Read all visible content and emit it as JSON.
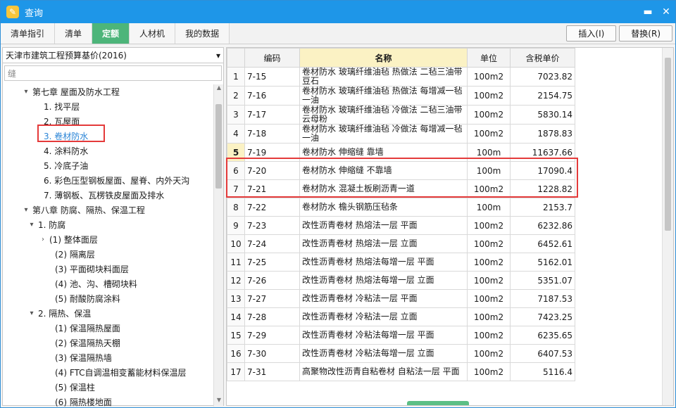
{
  "window": {
    "title": "查询",
    "minimize_symbol": "▬",
    "close_symbol": "✕",
    "app_icon_glyph": "✎"
  },
  "tabs": [
    {
      "label": "清单指引",
      "active": false
    },
    {
      "label": "清单",
      "active": false
    },
    {
      "label": "定额",
      "active": true
    },
    {
      "label": "人材机",
      "active": false
    },
    {
      "label": "我的数据",
      "active": false
    }
  ],
  "buttons": {
    "insert": "插入(I)",
    "replace": "替换(R)"
  },
  "left": {
    "library": "天津市建筑工程预算基价(2016)",
    "search_placeholder": "缝",
    "tree": [
      {
        "indent": 2,
        "caret": "▾",
        "label": "第七章 屋面及防水工程"
      },
      {
        "indent": 4,
        "caret": "",
        "label": "1. 找平层"
      },
      {
        "indent": 4,
        "caret": "",
        "label": "2. 瓦屋面"
      },
      {
        "indent": 4,
        "caret": "",
        "label": "3. 卷材防水",
        "selected": true
      },
      {
        "indent": 4,
        "caret": "",
        "label": "4. 涂料防水"
      },
      {
        "indent": 4,
        "caret": "",
        "label": "5. 冷底子油"
      },
      {
        "indent": 4,
        "caret": "",
        "label": "6. 彩色压型钢板屋面、屋脊、内外天沟"
      },
      {
        "indent": 4,
        "caret": "",
        "label": "7. 薄钢板、瓦楞铁皮屋面及排水"
      },
      {
        "indent": 2,
        "caret": "▾",
        "label": "第八章 防腐、隔热、保温工程"
      },
      {
        "indent": 3,
        "caret": "▾",
        "label": "1. 防腐"
      },
      {
        "indent": 5,
        "caret": "›",
        "label": "(1) 整体面层"
      },
      {
        "indent": 6,
        "caret": "",
        "label": "(2) 隔离层"
      },
      {
        "indent": 6,
        "caret": "",
        "label": "(3) 平面砌块料面层"
      },
      {
        "indent": 6,
        "caret": "",
        "label": "(4) 池、沟、槽砌块料"
      },
      {
        "indent": 6,
        "caret": "",
        "label": "(5) 耐酸防腐涂料"
      },
      {
        "indent": 3,
        "caret": "▾",
        "label": "2. 隔热、保温"
      },
      {
        "indent": 6,
        "caret": "",
        "label": "(1) 保温隔热屋面"
      },
      {
        "indent": 6,
        "caret": "",
        "label": "(2) 保温隔热天棚"
      },
      {
        "indent": 6,
        "caret": "",
        "label": "(3) 保温隔热墙"
      },
      {
        "indent": 6,
        "caret": "",
        "label": "(4) FTC自调温相变蓄能材料保温层"
      },
      {
        "indent": 6,
        "caret": "",
        "label": "(5) 保温柱"
      },
      {
        "indent": 6,
        "caret": "",
        "label": "(6) 隔热楼地面"
      }
    ]
  },
  "table": {
    "headers": [
      "",
      "编码",
      "名称",
      "单位",
      "含税单价"
    ],
    "rows": [
      {
        "idx": "1",
        "code": "7-15",
        "name": "卷材防水 玻璃纤维油毡 热做法 二毡三油带豆石",
        "unit": "100m2",
        "price": "7023.82"
      },
      {
        "idx": "2",
        "code": "7-16",
        "name": "卷材防水 玻璃纤维油毡 热做法 每增减一毡一油",
        "unit": "100m2",
        "price": "2154.75"
      },
      {
        "idx": "3",
        "code": "7-17",
        "name": "卷材防水 玻璃纤维油毡 冷做法 二毡三油带云母粉",
        "unit": "100m2",
        "price": "5830.14"
      },
      {
        "idx": "4",
        "code": "7-18",
        "name": "卷材防水 玻璃纤维油毡 冷做法 每增减一毡一油",
        "unit": "100m2",
        "price": "1878.83"
      },
      {
        "idx": "5",
        "code": "7-19",
        "name": "卷材防水 伸缩缝 靠墙",
        "unit": "100m",
        "price": "11637.66",
        "highlight": true
      },
      {
        "idx": "6",
        "code": "7-20",
        "name": "卷材防水 伸缩缝 不靠墙",
        "unit": "100m",
        "price": "17090.4"
      },
      {
        "idx": "7",
        "code": "7-21",
        "name": "卷材防水 混凝土板刷沥青一道",
        "unit": "100m2",
        "price": "1228.82"
      },
      {
        "idx": "8",
        "code": "7-22",
        "name": "卷材防水 檐头钢筋压毡条",
        "unit": "100m",
        "price": "2153.7"
      },
      {
        "idx": "9",
        "code": "7-23",
        "name": "改性沥青卷材 热熔法一层 平面",
        "unit": "100m2",
        "price": "6232.86"
      },
      {
        "idx": "10",
        "code": "7-24",
        "name": "改性沥青卷材 热熔法一层 立面",
        "unit": "100m2",
        "price": "6452.61"
      },
      {
        "idx": "11",
        "code": "7-25",
        "name": "改性沥青卷材 热熔法每增一层 平面",
        "unit": "100m2",
        "price": "5162.01"
      },
      {
        "idx": "12",
        "code": "7-26",
        "name": "改性沥青卷材 热熔法每增一层 立面",
        "unit": "100m2",
        "price": "5351.07"
      },
      {
        "idx": "13",
        "code": "7-27",
        "name": "改性沥青卷材 冷粘法一层 平面",
        "unit": "100m2",
        "price": "7187.53"
      },
      {
        "idx": "14",
        "code": "7-28",
        "name": "改性沥青卷材 冷粘法一层 立面",
        "unit": "100m2",
        "price": "7423.25"
      },
      {
        "idx": "15",
        "code": "7-29",
        "name": "改性沥青卷材 冷粘法每增一层 平面",
        "unit": "100m2",
        "price": "6235.65"
      },
      {
        "idx": "16",
        "code": "7-30",
        "name": "改性沥青卷材 冷粘法每增一层 立面",
        "unit": "100m2",
        "price": "6407.53"
      },
      {
        "idx": "17",
        "code": "7-31",
        "name": "高聚物改性沥青自粘卷材 自粘法一层 平面",
        "unit": "100m2",
        "price": "5116.4"
      }
    ]
  },
  "colors": {
    "titlebar": "#1e96e8",
    "active_tab": "#4db57a",
    "header_highlight": "#fbf2c4",
    "annotation_red": "#e43a3a",
    "selected_text": "#2a84d6"
  }
}
